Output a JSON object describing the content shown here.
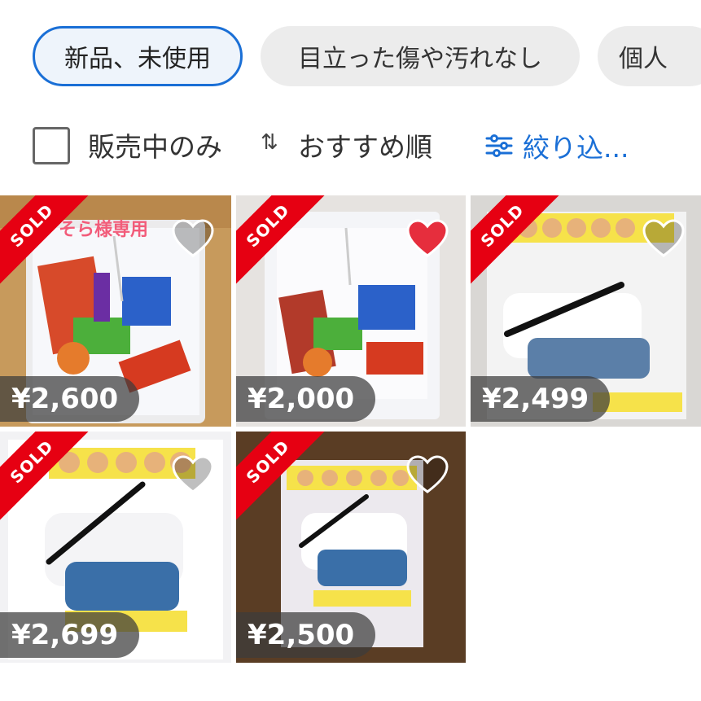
{
  "chips": [
    {
      "label": "新品、未使用",
      "active": true
    },
    {
      "label": "目立った傷や汚れなし",
      "active": false
    },
    {
      "label": "個人",
      "active": false
    }
  ],
  "filter": {
    "on_sale_only_label": "販売中のみ",
    "sort_icon": "⇅",
    "sort_label": "おすすめ順",
    "refine_label": "絞り込..."
  },
  "colors": {
    "accent": "#1a6fd6",
    "sold": "#e60012",
    "liked_heart": "#e62e3d"
  },
  "items": [
    {
      "sold_label": "SOLD",
      "price": "¥2,600",
      "liked": false,
      "note": "そら様専用"
    },
    {
      "sold_label": "SOLD",
      "price": "¥2,000",
      "liked": true
    },
    {
      "sold_label": "SOLD",
      "price": "¥2,499",
      "liked": false
    },
    {
      "sold_label": "SOLD",
      "price": "¥2,699",
      "liked": false
    },
    {
      "sold_label": "SOLD",
      "price": "¥2,500",
      "liked": false
    }
  ]
}
